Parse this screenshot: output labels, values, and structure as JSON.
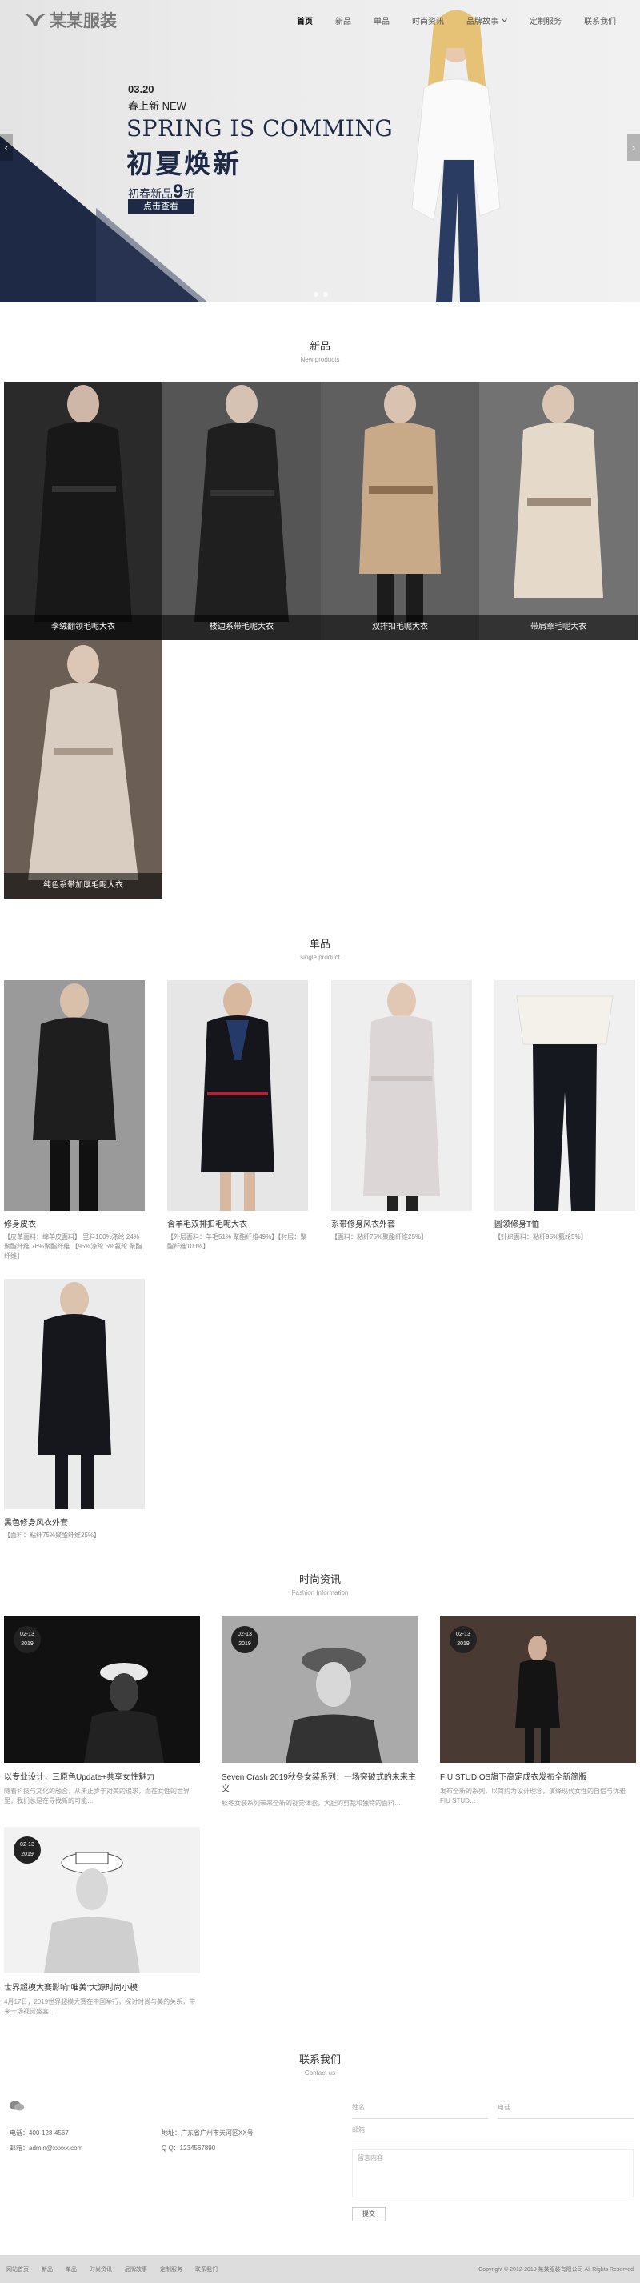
{
  "header": {
    "logo_text": "某某服装",
    "nav": [
      {
        "label": "首页",
        "active": true
      },
      {
        "label": "新品"
      },
      {
        "label": "单品"
      },
      {
        "label": "时尚资讯"
      },
      {
        "label": "品牌故事",
        "dropdown": true
      },
      {
        "label": "定制服务"
      },
      {
        "label": "联系我们"
      }
    ]
  },
  "hero": {
    "date": "03.20",
    "tag": "春上新 NEW",
    "title": "SPRING IS COMMING",
    "title_cn": "初夏焕新",
    "sale_prefix": "初春新品",
    "sale_num": "9",
    "sale_suffix": "折",
    "button": "点击查看",
    "prev_arrow": "‹",
    "next_arrow": "›",
    "slides": 2
  },
  "new_products": {
    "title": "新品",
    "subtitle": "New products",
    "items": [
      {
        "caption": "李绒翻领毛呢大衣",
        "color": "#2a2a2a",
        "coat": "#1c1c1c"
      },
      {
        "caption": "楼边系带毛呢大衣",
        "color": "#555555",
        "coat": "#222222"
      },
      {
        "caption": "双排扣毛呢大衣",
        "color": "#5f5f5f",
        "coat": "#c8a988"
      },
      {
        "caption": "带肩章毛呢大衣",
        "color": "#727272",
        "coat": "#e5d9c9"
      },
      {
        "caption": "纯色系带加厚毛呢大衣",
        "color": "#6a5e55",
        "coat": "#d9cdc2"
      }
    ]
  },
  "single_products": {
    "title": "单品",
    "subtitle": "single product",
    "items": [
      {
        "name": "修身皮衣",
        "desc": "【皮革面料：绵羊皮面料】 里料100%涤纶 24%聚酯纤维 76%聚酯纤维 【95%涤纶 5%氨纶 聚酯纤维】",
        "bg": "#9a9a9a",
        "coat": "#1e1e1e"
      },
      {
        "name": "含羊毛双排扣毛呢大衣",
        "desc": "【外层面料：羊毛51% 聚酯纤维49%】【衬层：聚酯纤维100%】",
        "bg": "#e6e6e6",
        "coat": "#14161c"
      },
      {
        "name": "系带修身风衣外套",
        "desc": "【面料：粘纤75%聚酯纤维25%】",
        "bg": "#eeeeee",
        "coat": "#ddd6d6"
      },
      {
        "name": "圆领修身T恤",
        "desc": "【针织面料：粘纤95%氨纶5%】",
        "bg": "#f0f0f0",
        "coat": "#f3f1ea"
      },
      {
        "name": "黑色修身风衣外套",
        "desc": "【面料：粘纤75%聚酯纤维25%】",
        "bg": "#ebebeb",
        "coat": "#15171c"
      }
    ]
  },
  "news": {
    "title": "时尚资讯",
    "subtitle": "Fashion Information",
    "items": [
      {
        "date_md": "02-13",
        "date_y": "2019",
        "title": "以专业设计，三原色Update+共享女性魅力",
        "desc": "随着科技与文化的融合，从未止步于对美的追求，而在女性的世界里，我们总是在寻找新的可能…",
        "bg": "#111111"
      },
      {
        "date_md": "02-13",
        "date_y": "2019",
        "title": "Seven Crash 2019秋冬女装系列：一场突破式的未来主义",
        "desc": "秋冬女装系列带来全新的视觉体验，大胆的剪裁和独特的面料…",
        "bg": "#9b9b9b"
      },
      {
        "date_md": "02-13",
        "date_y": "2019",
        "title": "FIU STUDIOS旗下高定成衣发布全新简版",
        "desc": "发布全新的系列，以简约为设计理念，演绎现代女性的自信与优雅 FIU STUD…",
        "bg": "#3a2f2c"
      },
      {
        "date_md": "02-13",
        "date_y": "2019",
        "title": "世界超模大赛影响\"唯美\"大源时尚小模",
        "desc": "4月17日，2019世界超模大赛在中国举行，探讨时尚与美的关系，带来一场视觉盛宴…",
        "bg": "#ffffff"
      }
    ]
  },
  "contact": {
    "title": "联系我们",
    "subtitle": "Contact us",
    "phone": "电话：400-123-4567",
    "address": "地址：广东省广州市天河区XX号",
    "email": "邮箱：admin@xxxxx.com",
    "qq": "Q Q：1234567890",
    "form": {
      "name": "姓名",
      "phone": "电话",
      "email": "邮箱",
      "message": "留言内容",
      "submit": "提交"
    }
  },
  "footer": {
    "links": [
      "网站首页",
      "新品",
      "单品",
      "时尚资讯",
      "品牌故事",
      "定制服务",
      "联系我们"
    ],
    "copyright": "Copyright © 2012-2019 某某服装有限公司 All Rights Reserved"
  },
  "colors": {
    "navy": "#1e2a45",
    "footer_bg": "#dddddd"
  }
}
